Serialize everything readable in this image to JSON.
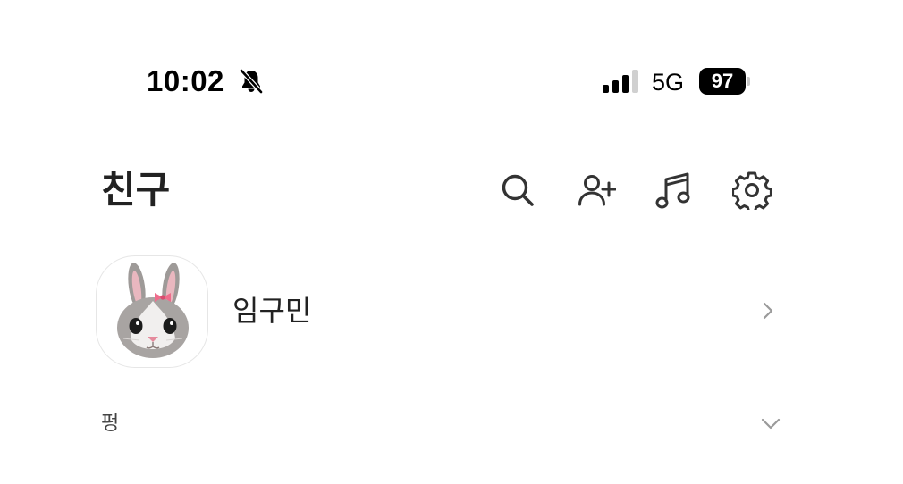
{
  "status_bar": {
    "time": "10:02",
    "network": "5G",
    "battery": "97",
    "icons": [
      "bell-slash-icon",
      "signal-bars-icon",
      "battery-icon"
    ]
  },
  "header": {
    "title": "친구",
    "actions": [
      {
        "name": "search",
        "icon": "search-icon"
      },
      {
        "name": "add-friend",
        "icon": "add-person-icon"
      },
      {
        "name": "music",
        "icon": "music-note-icon"
      },
      {
        "name": "settings",
        "icon": "gear-icon"
      }
    ]
  },
  "profile": {
    "name": "임구민",
    "avatar": "bunny-memoji-avatar"
  },
  "sections": [
    {
      "label": "펑",
      "state": "collapsed"
    }
  ],
  "colors": {
    "background": "#ffffff",
    "text": "#222222",
    "icon": "#333333",
    "chevron": "#9a9a9a"
  }
}
